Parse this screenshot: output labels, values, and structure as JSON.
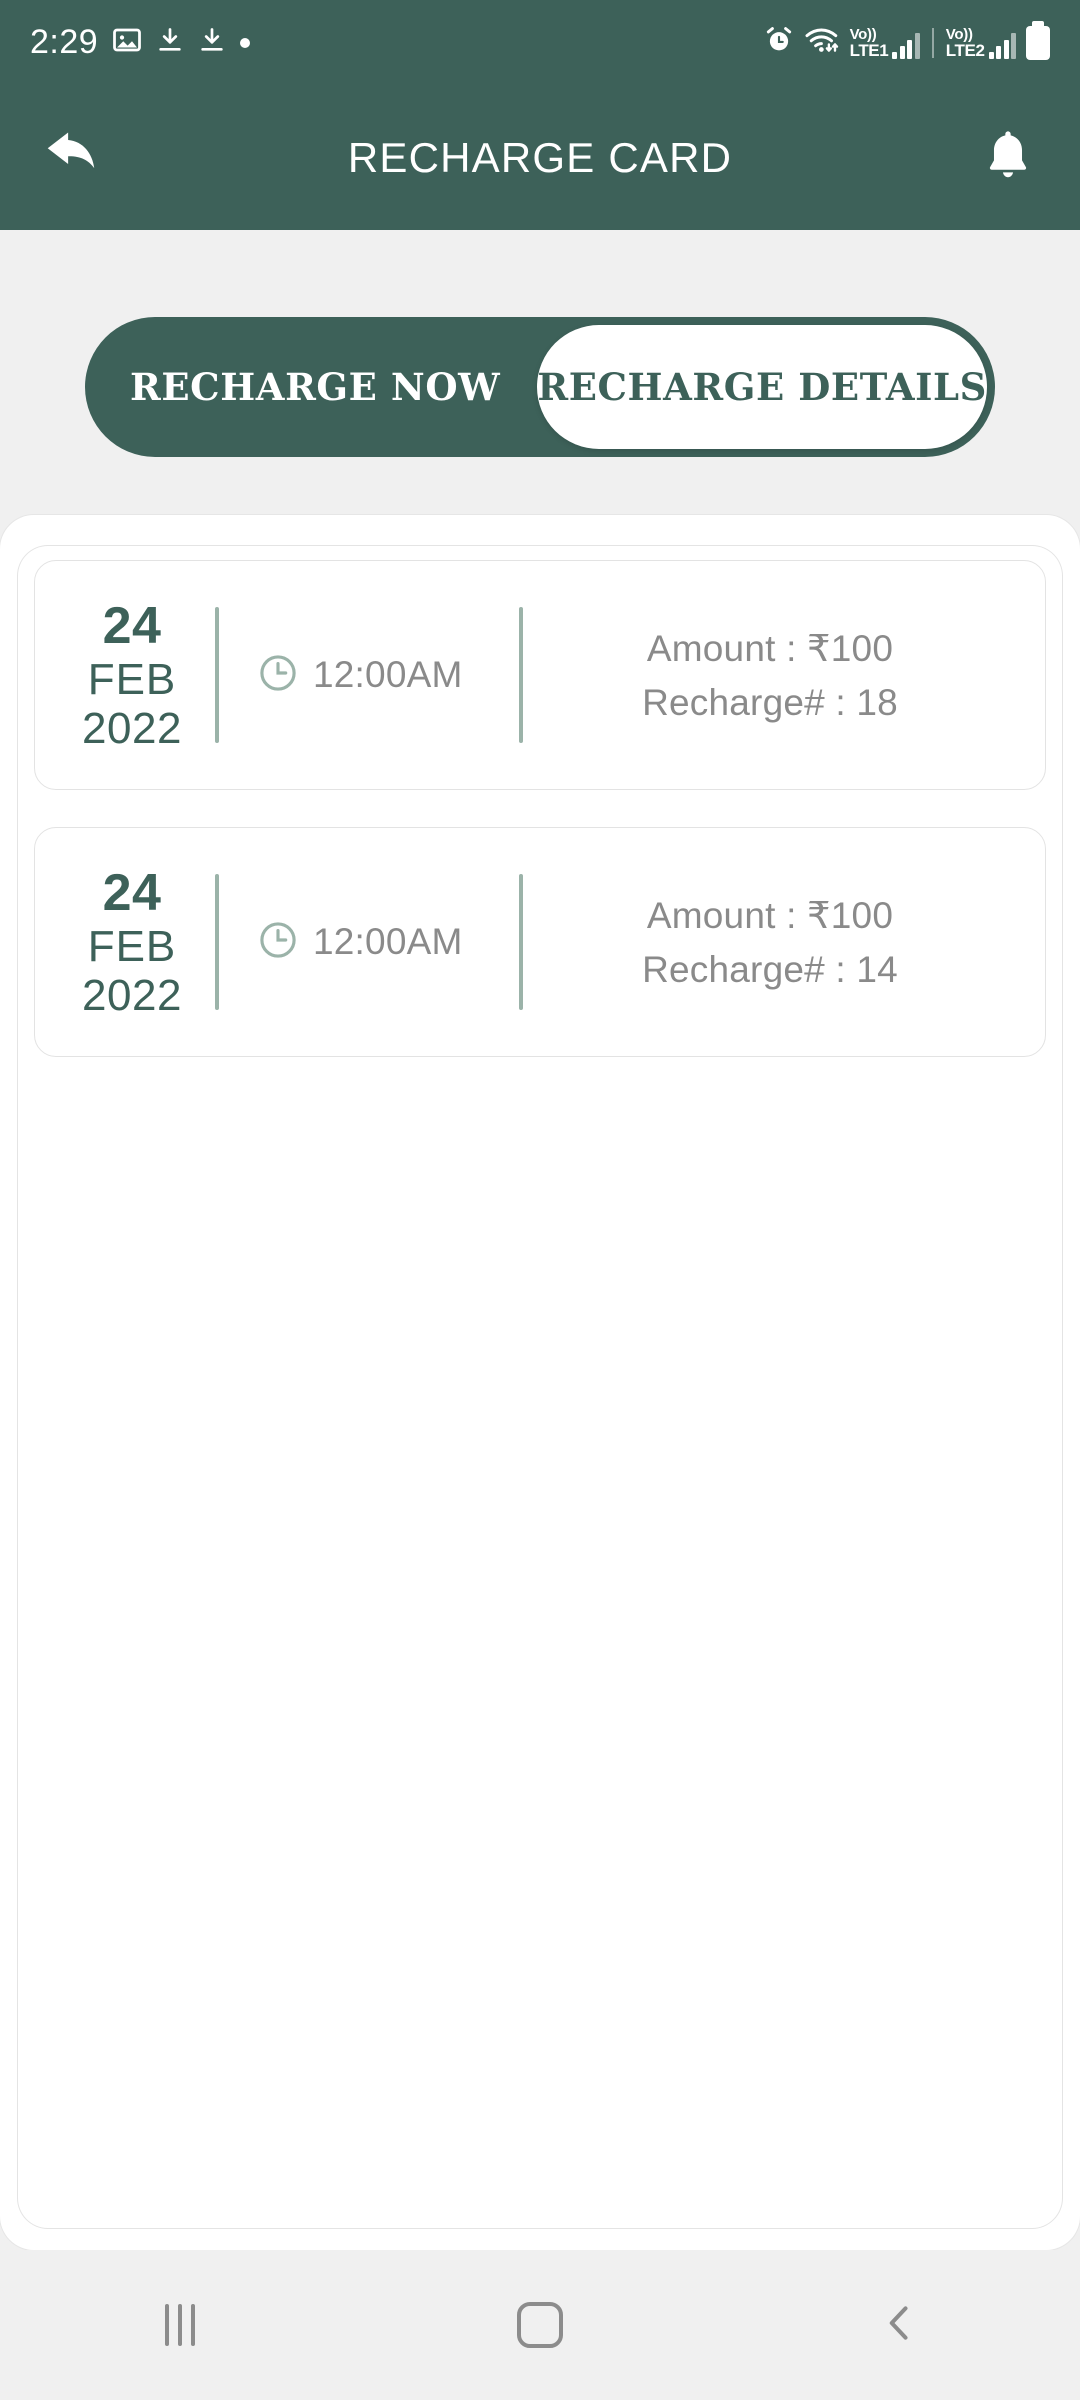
{
  "status_bar": {
    "time": "2:29",
    "left_icons": [
      "image-icon",
      "download-icon",
      "download-icon",
      "dot-indicator-icon"
    ],
    "right_icons": [
      "alarm-icon",
      "wifi-icon",
      "signal-sim1-icon",
      "signal-sim2-icon",
      "battery-icon"
    ],
    "sim1": {
      "volte": "Vo))",
      "network": "LTE1"
    },
    "sim2": {
      "volte": "Vo))",
      "network": "LTE2"
    }
  },
  "app_bar": {
    "title": "RECHARGE CARD",
    "back_icon": "back-arrow-icon",
    "notification_icon": "bell-icon"
  },
  "toggle": {
    "options": [
      {
        "label": "RECHARGE NOW",
        "selected": false
      },
      {
        "label": "RECHARGE DETAILS",
        "selected": true
      }
    ]
  },
  "recharges": [
    {
      "day": "24",
      "month": "FEB",
      "year": "2022",
      "time": "12:00AM",
      "amount_line": "Amount : ₹100",
      "recharge_line": "Recharge# : 18",
      "clock_icon": "clock-icon"
    },
    {
      "day": "24",
      "month": "FEB",
      "year": "2022",
      "time": "12:00AM",
      "amount_line": "Amount : ₹100",
      "recharge_line": "Recharge# : 14",
      "clock_icon": "clock-icon"
    }
  ],
  "nav_bar": {
    "recents_icon": "recents-icon",
    "home_icon": "home-icon",
    "back_icon": "back-chevron-icon"
  },
  "colors": {
    "brand": "#3d6159",
    "page_bg": "#f0f0f0",
    "card_bg": "#ffffff",
    "muted_text": "#8a8a8a",
    "divider": "#9bb3a9"
  }
}
